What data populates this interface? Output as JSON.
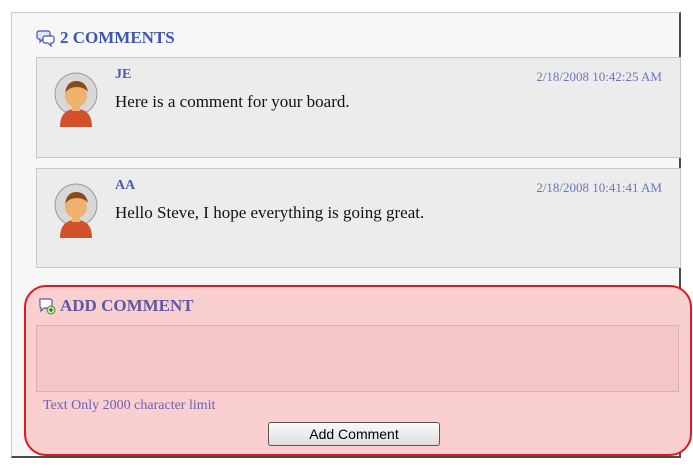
{
  "comments_section": {
    "header": "2 COMMENTS",
    "icon": "speech-bubble-icon",
    "items": [
      {
        "author": "JE",
        "timestamp": "2/18/2008 10:42:25 AM",
        "text": "Here is a comment for your board.",
        "avatar": "user-avatar-icon"
      },
      {
        "author": "AA",
        "timestamp": "2/18/2008 10:41:41 AM",
        "text": "Hello Steve, I hope everything is going great.",
        "avatar": "user-avatar-icon"
      }
    ]
  },
  "add_comment": {
    "header": "ADD COMMENT",
    "icon": "add-comment-icon",
    "input_value": "",
    "limit_text": "Text Only 2000 character limit",
    "button_label": "Add Comment"
  },
  "colors": {
    "header_blue": "#3d55b8",
    "highlight_fill": "#f9cfd0",
    "highlight_border": "#e01822"
  }
}
